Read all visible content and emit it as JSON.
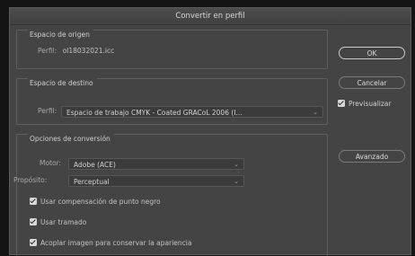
{
  "dialog": {
    "title": "Convertir en perfil"
  },
  "origin": {
    "legend": "Espacio de origen",
    "profile_label": "Perfil:",
    "profile_value": "ol18032021.icc"
  },
  "destination": {
    "legend": "Espacio de destino",
    "profile_label": "Perfil:",
    "profile_value": "Espacio de trabajo CMYK - Coated GRACoL 2006 (I..."
  },
  "options": {
    "legend": "Opciones de conversión",
    "engine_label": "Motor:",
    "engine_value": "Adobe (ACE)",
    "intent_label": "Propósito:",
    "intent_value": "Perceptual",
    "black_point": {
      "label": "Usar compensación de punto negro",
      "checked": true
    },
    "dither": {
      "label": "Usar tramado",
      "checked": true
    },
    "flatten": {
      "label": "Acoplar imagen para conservar la apariencia",
      "checked": true
    }
  },
  "buttons": {
    "ok": "OK",
    "cancel": "Cancelar",
    "preview_label": "Previsualizar",
    "preview_checked": true,
    "advanced": "Avanzado"
  },
  "icons": {
    "dropdown": "chevron-down-icon",
    "checkbox": "checkmark-icon"
  }
}
